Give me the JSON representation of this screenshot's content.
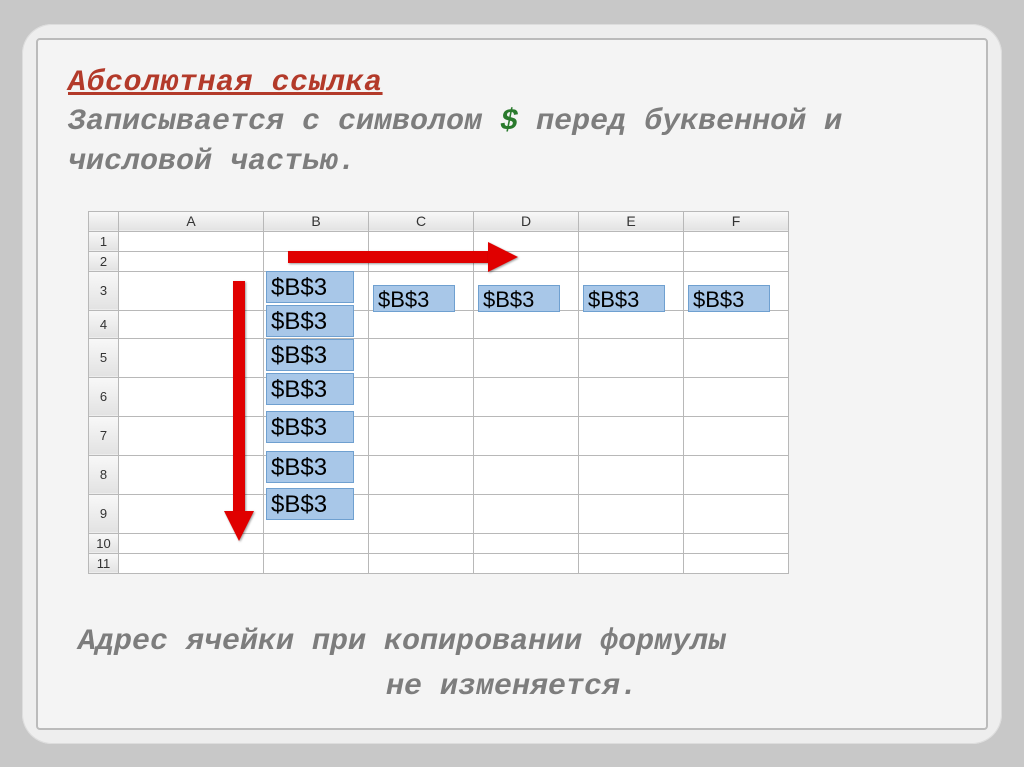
{
  "title": "Абсолютная ссылка",
  "subtitle_before": "Записывается с символом ",
  "subtitle_symbol": "$",
  "subtitle_after": " перед буквенной и числовой частью.",
  "columns": [
    "A",
    "B",
    "C",
    "D",
    "E",
    "F"
  ],
  "rows": [
    "1",
    "2",
    "3",
    "4",
    "5",
    "6",
    "7",
    "8",
    "9",
    "10",
    "11"
  ],
  "cell_value": "$B$3",
  "b_column_cells": [
    "$B$3",
    "$B$3",
    "$B$3",
    "$B$3",
    "$B$3",
    "$B$3",
    "$B$3"
  ],
  "row3_cells": [
    "$B$3",
    "$B$3",
    "$B$3",
    "$B$3"
  ],
  "footer_line1": "Адрес ячейки при копировании формулы",
  "footer_line2": "не изменяется."
}
